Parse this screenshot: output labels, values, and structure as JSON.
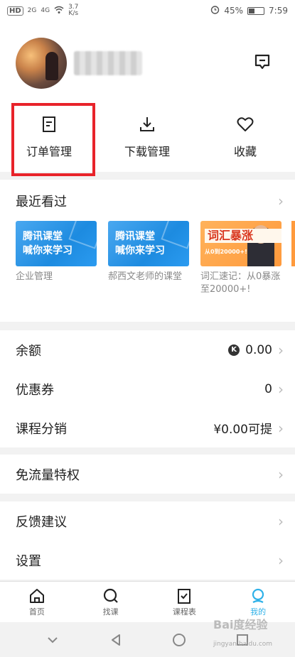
{
  "status": {
    "left_labels": [
      "HD",
      "2G",
      "4G"
    ],
    "speed": "3.7\nK/s",
    "battery": "45%",
    "time": "7:59",
    "battery_level": 0.45
  },
  "quick_actions": [
    {
      "label": "订单管理",
      "icon": "order-icon"
    },
    {
      "label": "下载管理",
      "icon": "download-icon"
    },
    {
      "label": "收藏",
      "icon": "heart-icon"
    }
  ],
  "recent": {
    "title": "最近看过",
    "courses": [
      {
        "thumb_line1": "腾讯课堂",
        "thumb_line2": "喊你来学习",
        "caption": "企业管理"
      },
      {
        "thumb_line1": "腾讯课堂",
        "thumb_line2": "喊你来学习",
        "caption": "郝西文老师的课堂"
      },
      {
        "thumb_title": "词汇暴涨",
        "thumb_sub": "从0到20000+!",
        "caption": "词汇速记：从0暴涨至20000+!"
      }
    ]
  },
  "wallet": [
    {
      "label": "余额",
      "value": "0.00"
    },
    {
      "label": "优惠券",
      "value": "0"
    },
    {
      "label": "课程分销",
      "value": "¥0.00可提"
    }
  ],
  "privilege": {
    "label": "免流量特权"
  },
  "settings": [
    {
      "label": "反馈建议"
    },
    {
      "label": "设置"
    }
  ],
  "tabs": [
    {
      "label": "首页",
      "icon": "home-icon"
    },
    {
      "label": "找课",
      "icon": "search-icon"
    },
    {
      "label": "课程表",
      "icon": "schedule-icon"
    },
    {
      "label": "我的",
      "icon": "profile-icon"
    }
  ],
  "watermark": {
    "text": "Bai度经验",
    "sub": "jingyan.baidu.com"
  },
  "colors": {
    "accent": "#2fb1e8",
    "highlight": "#e8232a"
  }
}
